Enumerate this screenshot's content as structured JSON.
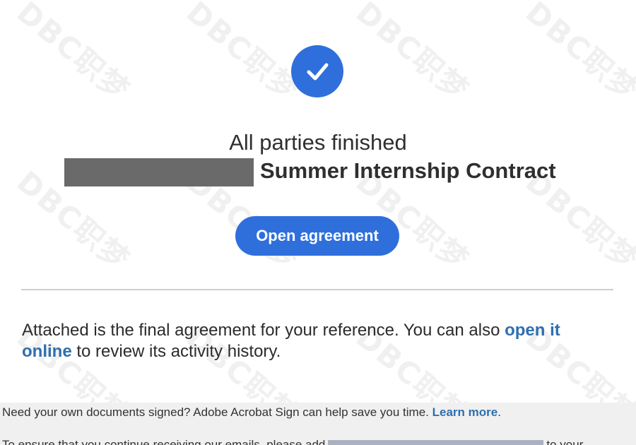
{
  "confirmation": {
    "icon": "checkmark-icon",
    "heading": "All parties finished",
    "document_title": "Summer Internship Contract",
    "open_button_label": "Open agreement"
  },
  "message": {
    "text_before_link": "Attached is the final agreement for your reference. You can also ",
    "link_label": "open it online",
    "text_after_link": " to review its activity history."
  },
  "footer": {
    "promo_text": "Need your own documents signed? Adobe Acrobat Sign can help save you time. ",
    "learn_more_label": "Learn more",
    "promo_end": ".",
    "notice_start": "To ensure that you continue receiving our emails, please add",
    "notice_end": "to your"
  },
  "watermark": {
    "text": "DBC职梦"
  },
  "colors": {
    "accent": "#2f6fdc",
    "link": "#2f6fb0",
    "redaction": "#6a6a6a"
  }
}
